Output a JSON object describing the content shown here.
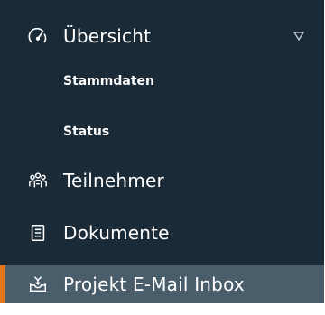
{
  "nav": {
    "overview": {
      "label": "Übersicht",
      "icon": "gauge-icon",
      "expanded": true,
      "sub_items": [
        {
          "label": "Stammdaten"
        },
        {
          "label": "Status"
        }
      ]
    },
    "items": [
      {
        "label": "Teilnehmer",
        "icon": "users-icon"
      },
      {
        "label": "Dokumente",
        "icon": "document-icon"
      },
      {
        "label": "Projekt E-Mail Inbox",
        "icon": "inbox-icon",
        "active": true
      }
    ]
  },
  "colors": {
    "background": "#1b2a37",
    "active_background": "#4a5d6b",
    "accent": "#e2761f",
    "text": "#ffffff"
  }
}
